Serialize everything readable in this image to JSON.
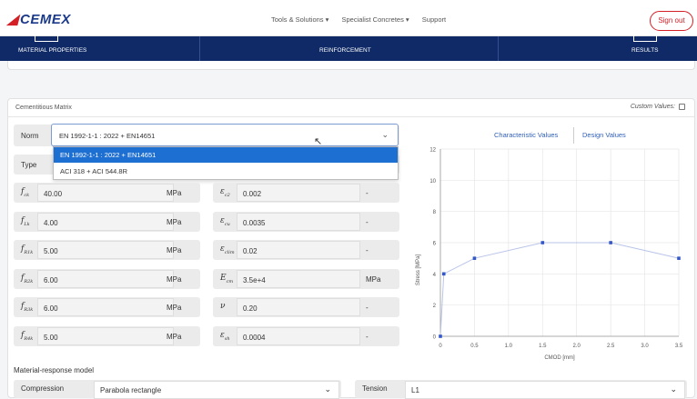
{
  "header": {
    "logo": "CEMEX",
    "nav": [
      "Tools & Solutions ▾",
      "Specialist Concretes ▾",
      "Support"
    ],
    "signout": "Sign out"
  },
  "steps": [
    "MATERIAL PROPERTIES",
    "REINFORCEMENT",
    "RESULTS"
  ],
  "panel": {
    "title": "Cementitious Matrix",
    "custom_values": "Custom Values:"
  },
  "norm": {
    "label": "Norm",
    "selected": "EN 1992-1-1 : 2022 + EN14651",
    "options": [
      "EN 1992-1-1 : 2022 + EN14651",
      "ACI 318 + ACI 544.8R"
    ]
  },
  "type": {
    "label": "Type"
  },
  "params_left": [
    {
      "sym": "f",
      "sub": "ck",
      "value": "40.00",
      "unit": "MPa"
    },
    {
      "sym": "f",
      "sub": "Lk",
      "value": "4.00",
      "unit": "MPa"
    },
    {
      "sym": "f",
      "sub": "R1k",
      "value": "5.00",
      "unit": "MPa"
    },
    {
      "sym": "f",
      "sub": "R2k",
      "value": "6.00",
      "unit": "MPa"
    },
    {
      "sym": "f",
      "sub": "R3k",
      "value": "6.00",
      "unit": "MPa"
    },
    {
      "sym": "f",
      "sub": "R4k",
      "value": "5.00",
      "unit": "MPa"
    }
  ],
  "params_right": [
    {
      "sym": "ε",
      "sub": "c2",
      "value": "0.002",
      "unit": "-"
    },
    {
      "sym": "ε",
      "sub": "cu",
      "value": "0.0035",
      "unit": "-"
    },
    {
      "sym": "ε",
      "sub": "clim",
      "value": "0.02",
      "unit": "-"
    },
    {
      "sym": "E",
      "sub": "cm",
      "value": "3.5e+4",
      "unit": "MPa"
    },
    {
      "sym": "ν",
      "sub": "",
      "value": "0.20",
      "unit": "-"
    },
    {
      "sym": "ε",
      "sub": "sh",
      "value": "0.0004",
      "unit": "-"
    }
  ],
  "chart_tabs": [
    "Characteristic Values",
    "Design Values"
  ],
  "response_model": {
    "title": "Material-response model",
    "compression_label": "Compression",
    "compression_value": "Parabola rectangle",
    "tension_label": "Tension",
    "tension_value": "L1"
  },
  "colors": {
    "brand_blue": "#0f2a66",
    "accent_red": "#d31f26",
    "link_blue": "#2f5fb8",
    "series": "#3457c8"
  },
  "chart_data": {
    "type": "line",
    "xlabel": "CMOD [mm]",
    "ylabel": "Stress [MPa]",
    "xlim": [
      0,
      3.5
    ],
    "ylim": [
      0,
      12
    ],
    "xticks": [
      "0",
      "0.5",
      "1.0",
      "1.5",
      "2.0",
      "2.5",
      "3.0",
      "3.5"
    ],
    "yticks": [
      "0",
      "2",
      "4",
      "6",
      "8",
      "10",
      "12"
    ],
    "x": [
      0,
      0.05,
      0.5,
      1.5,
      2.5,
      3.5
    ],
    "y": [
      0,
      4.0,
      5.0,
      6.0,
      6.0,
      5.0
    ],
    "grid": true
  }
}
